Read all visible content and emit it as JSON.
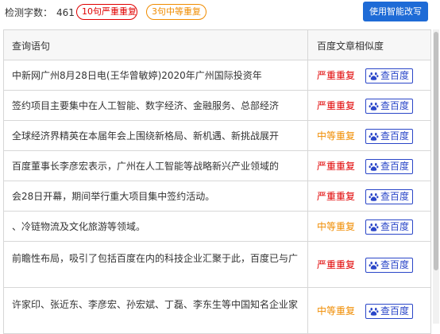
{
  "topbar": {
    "word_count_label": "检测字数：",
    "word_count_value": "461",
    "severe_badge": "10句严重重复",
    "medium_badge": "3句中等重复",
    "ai_rewrite_button": "使用智能改写"
  },
  "table": {
    "headers": {
      "query": "查询语句",
      "similarity": "百度文章相似度"
    },
    "check_button_label": "查百度",
    "rows": [
      {
        "query": "中新网广州8月28日电(王华曾敏婷)2020年广州国际投资年",
        "status": "严重重复",
        "level": "severe"
      },
      {
        "query": "签约项目主要集中在人工智能、数字经济、金融服务、总部经济",
        "status": "严重重复",
        "level": "severe"
      },
      {
        "query": "全球经济界精英在本届年会上围绕新格局、新机遇、新挑战展开",
        "status": "中等重复",
        "level": "medium"
      },
      {
        "query": "百度董事长李彦宏表示，广州在人工智能等战略新兴产业领域的",
        "status": "严重重复",
        "level": "severe"
      },
      {
        "query": "会28日开幕，期间举行重大项目集中签约活动。",
        "status": "严重重复",
        "level": "severe"
      },
      {
        "query": "、冷链物流及文化旅游等领域。",
        "status": "中等重复",
        "level": "medium"
      },
      {
        "query": "前瞻性布局，吸引了包括百度在内的科技企业汇聚于此，百度已与广",
        "status": "严重重复",
        "level": "severe"
      },
      {
        "query": "许家印、张近东、李彦宏、孙宏斌、丁磊、李东生等中国知名企业家",
        "status": "中等重复",
        "level": "medium"
      }
    ]
  },
  "colors": {
    "severe": "#e00000",
    "medium": "#f08c00",
    "primary_button": "#1e6bd6",
    "check_button": "#2a46c8"
  },
  "icons": {
    "check_button_icon": "baidu-paw-icon"
  }
}
